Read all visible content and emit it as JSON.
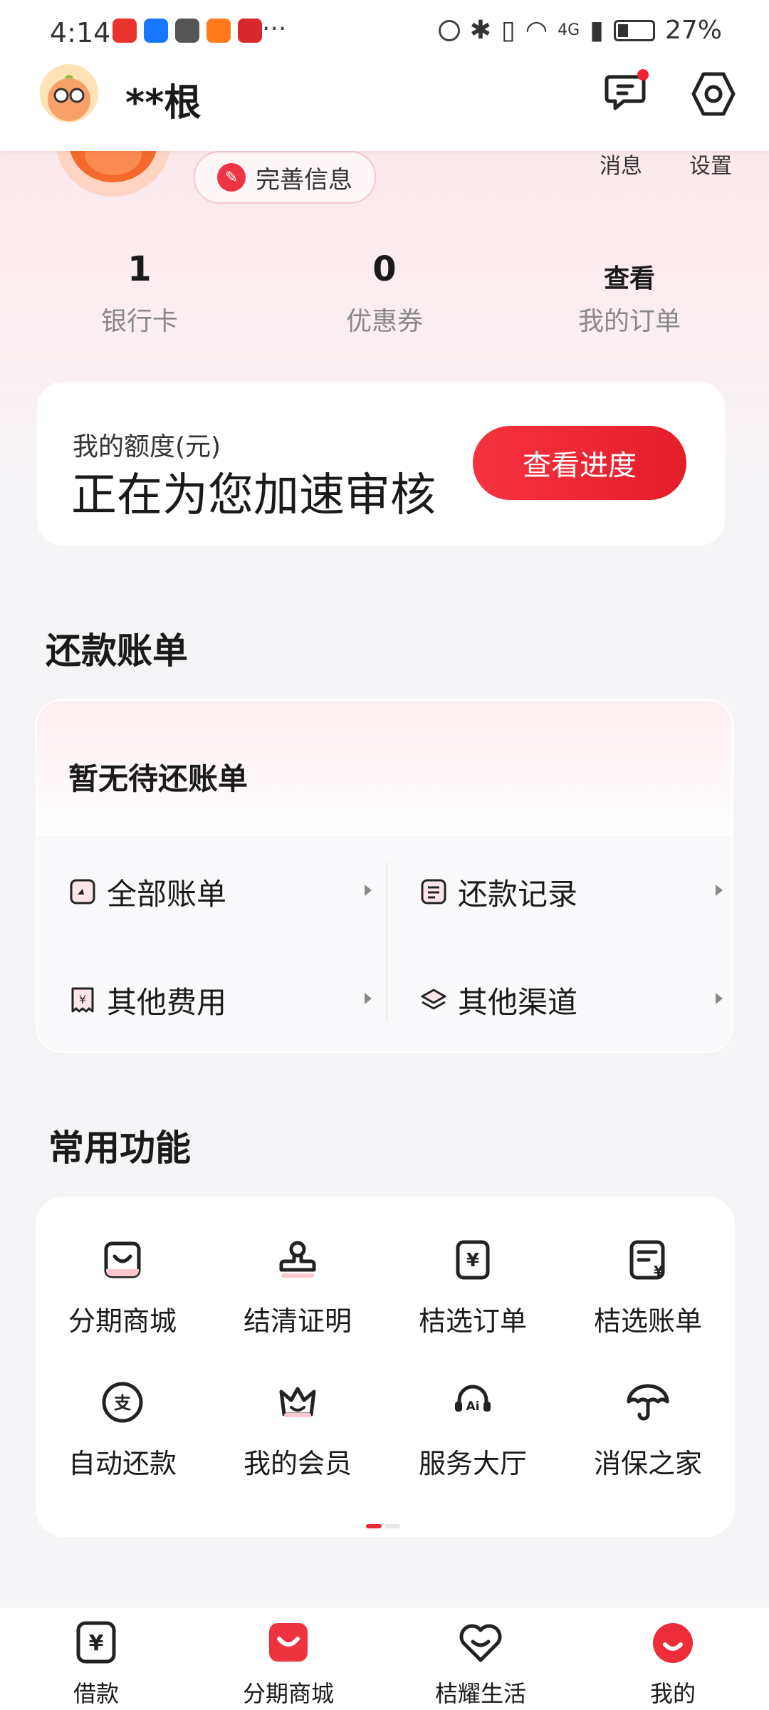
{
  "status_bar": {
    "time": "4:14",
    "more": "···",
    "battery": "27%",
    "network": "4G"
  },
  "header": {
    "name": "**根",
    "messages_icon": "chat-bubble-icon",
    "settings_icon": "hexagon-gear-icon"
  },
  "profile": {
    "complete_info": "完善信息",
    "messages_label": "消息",
    "settings_label": "设置",
    "stats": [
      {
        "value": "1",
        "label": "银行卡"
      },
      {
        "value": "0",
        "label": "优惠券"
      },
      {
        "value": "查看",
        "label": "我的订单"
      }
    ]
  },
  "credit": {
    "label": "我的额度(元)",
    "status": "正在为您加速审核",
    "button": "查看进度"
  },
  "repayment": {
    "title": "还款账单",
    "empty": "暂无待还账单",
    "items": [
      {
        "label": "全部账单",
        "icon": "bill-icon"
      },
      {
        "label": "还款记录",
        "icon": "list-icon"
      },
      {
        "label": "其他费用",
        "icon": "yuan-receipt-icon"
      },
      {
        "label": "其他渠道",
        "icon": "layers-icon"
      }
    ]
  },
  "functions": {
    "title": "常用功能",
    "items": [
      {
        "label": "分期商城",
        "icon": "shopping-bag-icon"
      },
      {
        "label": "结清证明",
        "icon": "stamp-icon"
      },
      {
        "label": "桔选订单",
        "icon": "yuan-order-icon"
      },
      {
        "label": "桔选账单",
        "icon": "yuan-bill-icon"
      },
      {
        "label": "自动还款",
        "icon": "auto-pay-icon"
      },
      {
        "label": "我的会员",
        "icon": "crown-icon"
      },
      {
        "label": "服务大厅",
        "icon": "ai-headset-icon"
      },
      {
        "label": "消保之家",
        "icon": "umbrella-icon"
      }
    ]
  },
  "bottom_nav": {
    "items": [
      {
        "label": "借款",
        "icon": "yuan-tab-icon"
      },
      {
        "label": "分期商城",
        "icon": "mall-tab-icon"
      },
      {
        "label": "桔耀生活",
        "icon": "heart-tab-icon"
      },
      {
        "label": "我的",
        "icon": "me-tab-icon"
      }
    ],
    "active_index": 3
  },
  "colors": {
    "accent": "#E52A35",
    "background": "#F5F5F7",
    "pink": "#FBE3E7"
  }
}
